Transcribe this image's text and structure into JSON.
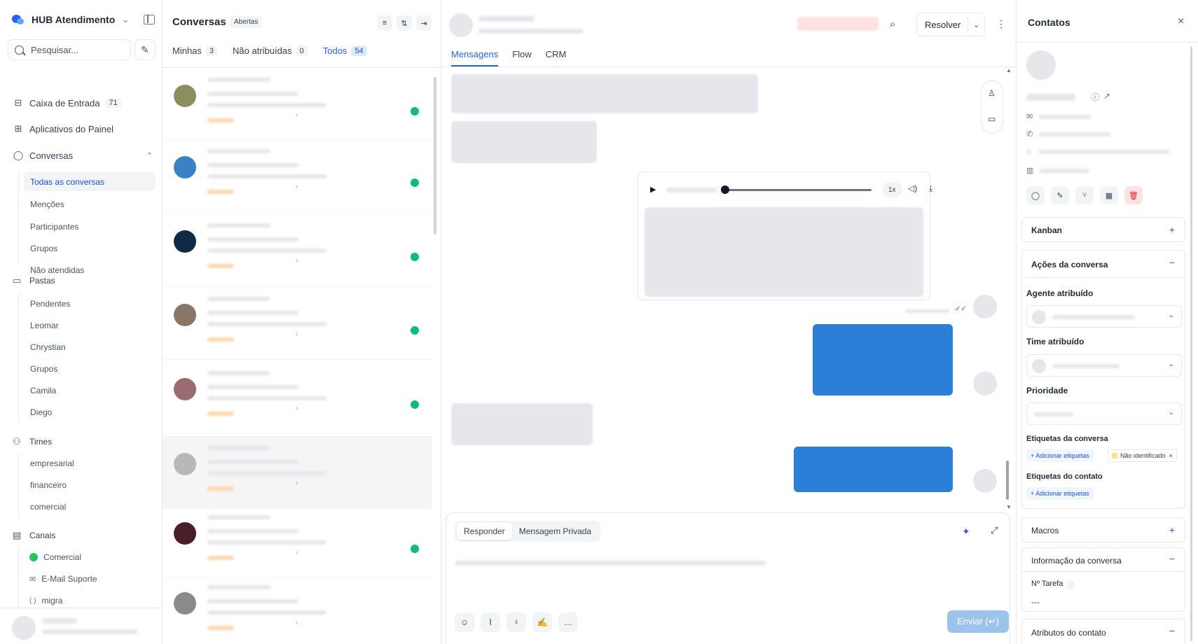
{
  "sidebar": {
    "brand": "HUB Atendimento",
    "search_placeholder": "Pesquisar...",
    "inbox": {
      "label": "Caixa de Entrada",
      "count": "71"
    },
    "apps": "Aplicativos do Painel",
    "conversations": "Conversas",
    "conv_items": [
      "Todas as conversas",
      "Menções",
      "Participantes",
      "Grupos",
      "Não atendidas"
    ],
    "folders": "Pastas",
    "folder_items": [
      "Pendentes",
      "Leomar",
      "Chrystian",
      "Grupos",
      "Camila",
      "Diego"
    ],
    "teams": "Times",
    "team_items": [
      "empresarial",
      "financeiro",
      "comercial"
    ],
    "channels": "Canais",
    "channel_items": [
      {
        "label": "Comercial",
        "icon": "whatsapp-icon",
        "color": "#22c55e"
      },
      {
        "label": "E-Mail Suporte",
        "icon": "mail-icon",
        "color": "#6b7280"
      },
      {
        "label": "migra",
        "icon": "api-icon",
        "color": "#6b7280"
      }
    ]
  },
  "conversations": {
    "title": "Conversas",
    "status": "Abertas",
    "tabs": [
      {
        "label": "Minhas",
        "count": "3"
      },
      {
        "label": "Não atribuídas",
        "count": "0"
      },
      {
        "label": "Todos",
        "count": "54"
      }
    ],
    "avatars": [
      "#8b8f5e",
      "#3b82c4",
      "#0f2a44",
      "#8a7666",
      "#9b6b72",
      "#b8b8b8",
      "#4a1f2a",
      "#8a8a8a"
    ]
  },
  "chat": {
    "tabs": [
      "Mensagens",
      "Flow",
      "CRM"
    ],
    "resolve": "Resolver",
    "audio_speed": "1x",
    "reply_modes": [
      "Responder",
      "Mensagem Privada"
    ],
    "send": "Enviar (↵)"
  },
  "contact": {
    "title": "Contatos",
    "kanban": "Kanban",
    "actions": "Ações da conversa",
    "agent": "Agente atribuído",
    "team": "Time atribuído",
    "priority": "Prioridade",
    "conv_labels": "Etiquetas da conversa",
    "add_labels": "+ Adicionar etiquetas",
    "tag_unidentified": "Não identificado",
    "contact_labels": "Etiquetas do contato",
    "macros": "Macros",
    "conv_info": "Informação da conversa",
    "task_no": "Nº Tarefa",
    "task_value": "---",
    "contact_attrs": "Atributos do contato"
  }
}
